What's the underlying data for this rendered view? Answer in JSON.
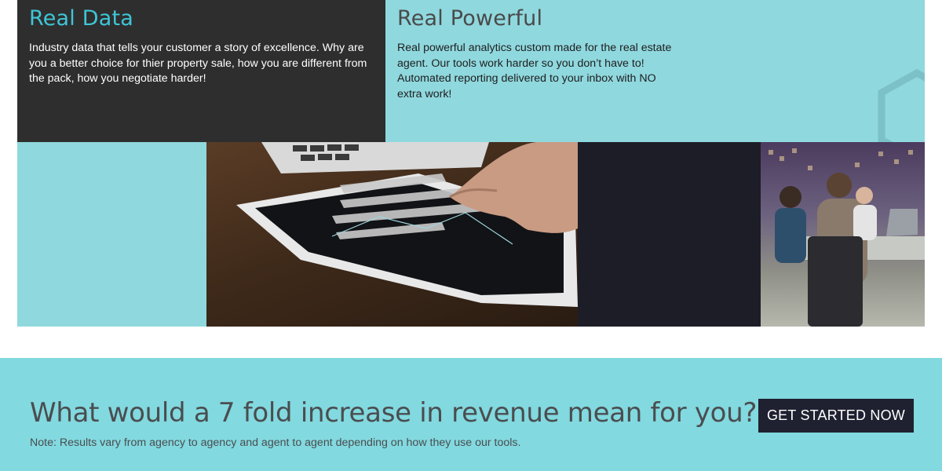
{
  "features": {
    "real_data": {
      "title": "Real Data",
      "body": "Industry data that tells your customer a story of excellence. Why are you a better choice for thier property sale, how you are different from the pack, how you negotiate harder!"
    },
    "real_powerful": {
      "title": "Real Powerful",
      "body": "Real powerful analytics custom made for the real estate agent. Our tools work harder so you don’t have to! Automated reporting delivered to your inbox with NO extra work!"
    }
  },
  "cta": {
    "headline": "What would a 7 fold increase in revenue mean for you?",
    "note": "Note: Results vary from agency to agency and agent to agent depending on how they use our tools.",
    "button_label": "GET STARTED NOW"
  },
  "colors": {
    "accent_teal": "#3ec6d8",
    "light_teal": "#8fd8de",
    "cta_band": "#82d9df",
    "dark_card": "#2e2e2e",
    "button_navy": "#1f2131"
  },
  "images": {
    "tablet_photo": "hand-on-tablet-with-charts-photo",
    "meeting_photo": "business-meeting-photo"
  }
}
